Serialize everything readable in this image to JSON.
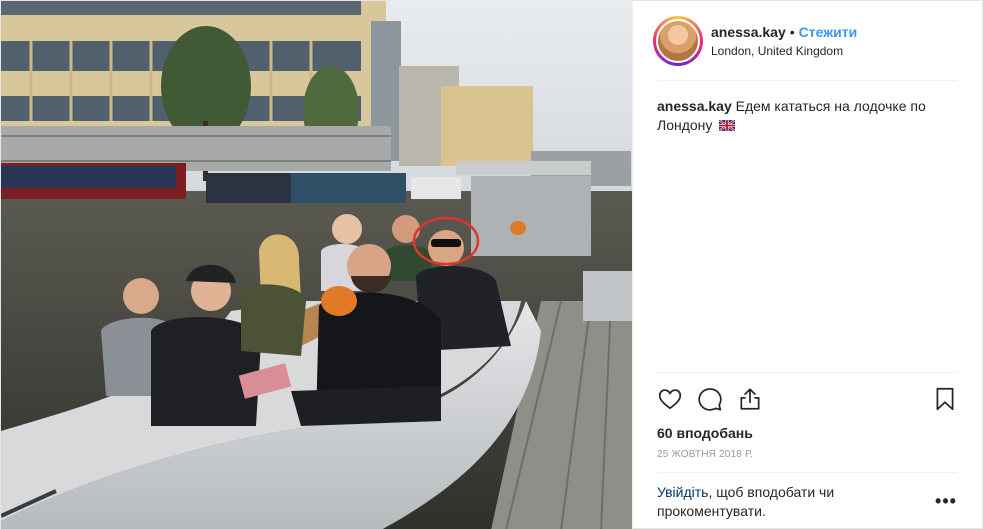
{
  "post": {
    "username": "anessa.kay",
    "separator": "•",
    "follow_label": "Стежити",
    "location": "London, United Kingdom",
    "caption_user": "anessa.kay",
    "caption_text": "Едем кататься на лодочке по Лондону",
    "caption_emoji": "gb-flag-icon",
    "likes": "60 вподобань",
    "date": "25 ЖОВТНЯ 2018 Р.",
    "comment_login": "Увійдіть",
    "comment_rest": ", щоб вподобати чи прокоментувати.",
    "more_label": "•••"
  },
  "icons": {
    "like": "heart-icon",
    "comment": "comment-icon",
    "share": "share-icon",
    "save": "bookmark-icon"
  },
  "colors": {
    "follow": "#3897f0",
    "login_link": "#003569",
    "text": "#262626",
    "muted": "#999999",
    "highlight_circle": "#e0342c"
  }
}
